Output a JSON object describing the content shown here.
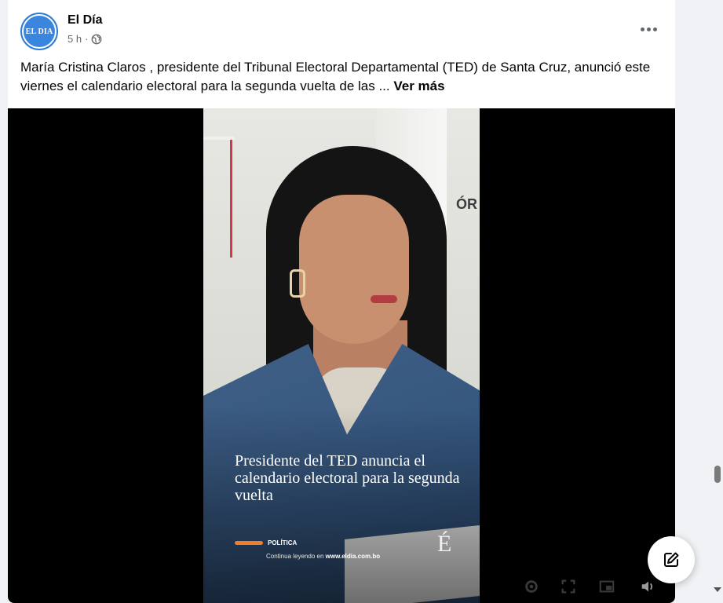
{
  "post": {
    "page_name": "El Día",
    "avatar_text": "EL DIA",
    "timestamp": "5 h",
    "separator": "·",
    "audience_icon": "globe-icon",
    "more_icon": "more-options-icon",
    "caption": "María Cristina Claros , presidente del Tribunal Electoral Departamental (TED) de Santa Cruz, anunció este viernes el calendario electoral para la segunda vuelta de las ...",
    "see_more": "Ver más"
  },
  "video": {
    "background_sign": "ÓR",
    "overlay_title": "Presidente del TED anuncia el calendario electoral para la segunda vuelta",
    "category": "POLÍTICA",
    "continue_prefix": "Continua leyendo en ",
    "continue_site": "www.eldia.com.bo",
    "brand_mark": "É",
    "controls": [
      "settings-icon",
      "fullscreen-icon",
      "picture-in-picture-icon",
      "volume-icon"
    ]
  },
  "floating": {
    "edit_icon": "edit-icon"
  },
  "colors": {
    "accent": "#f07d2b",
    "avatar_blue": "#3a85dd",
    "text_primary": "#050505",
    "text_secondary": "#65676b"
  }
}
